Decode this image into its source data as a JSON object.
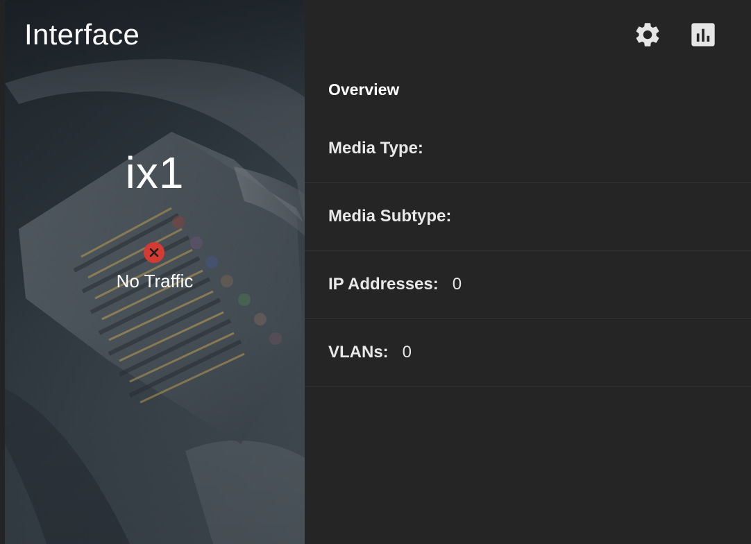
{
  "card": {
    "title": "Interface",
    "interface_name": "ix1",
    "status": {
      "icon": "error-x-icon",
      "text": "No Traffic",
      "color": "#d33b33"
    },
    "toolbar": {
      "settings_icon": "gear-icon",
      "stats_icon": "bar-chart-icon"
    },
    "overview": {
      "title": "Overview",
      "rows": [
        {
          "label": "Media Type:",
          "value": ""
        },
        {
          "label": "Media Subtype:",
          "value": ""
        },
        {
          "label": "IP Addresses:",
          "value": "0"
        },
        {
          "label": "VLANs:",
          "value": "0"
        }
      ]
    }
  }
}
